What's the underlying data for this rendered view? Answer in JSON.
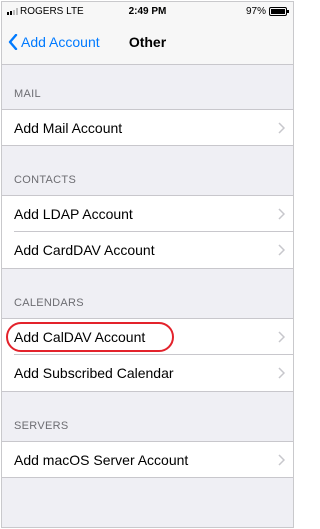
{
  "status_bar": {
    "carrier": "ROGERS  LTE",
    "time": "2:49 PM",
    "battery": "97%"
  },
  "nav": {
    "back_label": "Add Account",
    "title": "Other"
  },
  "sections": {
    "mail": {
      "header": "MAIL",
      "items": [
        "Add Mail Account"
      ]
    },
    "contacts": {
      "header": "CONTACTS",
      "items": [
        "Add LDAP Account",
        "Add CardDAV Account"
      ]
    },
    "calendars": {
      "header": "CALENDARS",
      "items": [
        "Add CalDAV Account",
        "Add Subscribed Calendar"
      ]
    },
    "servers": {
      "header": "SERVERS",
      "items": [
        "Add macOS Server Account"
      ]
    }
  },
  "colors": {
    "accent": "#007aff",
    "highlight": "#e3222b"
  }
}
